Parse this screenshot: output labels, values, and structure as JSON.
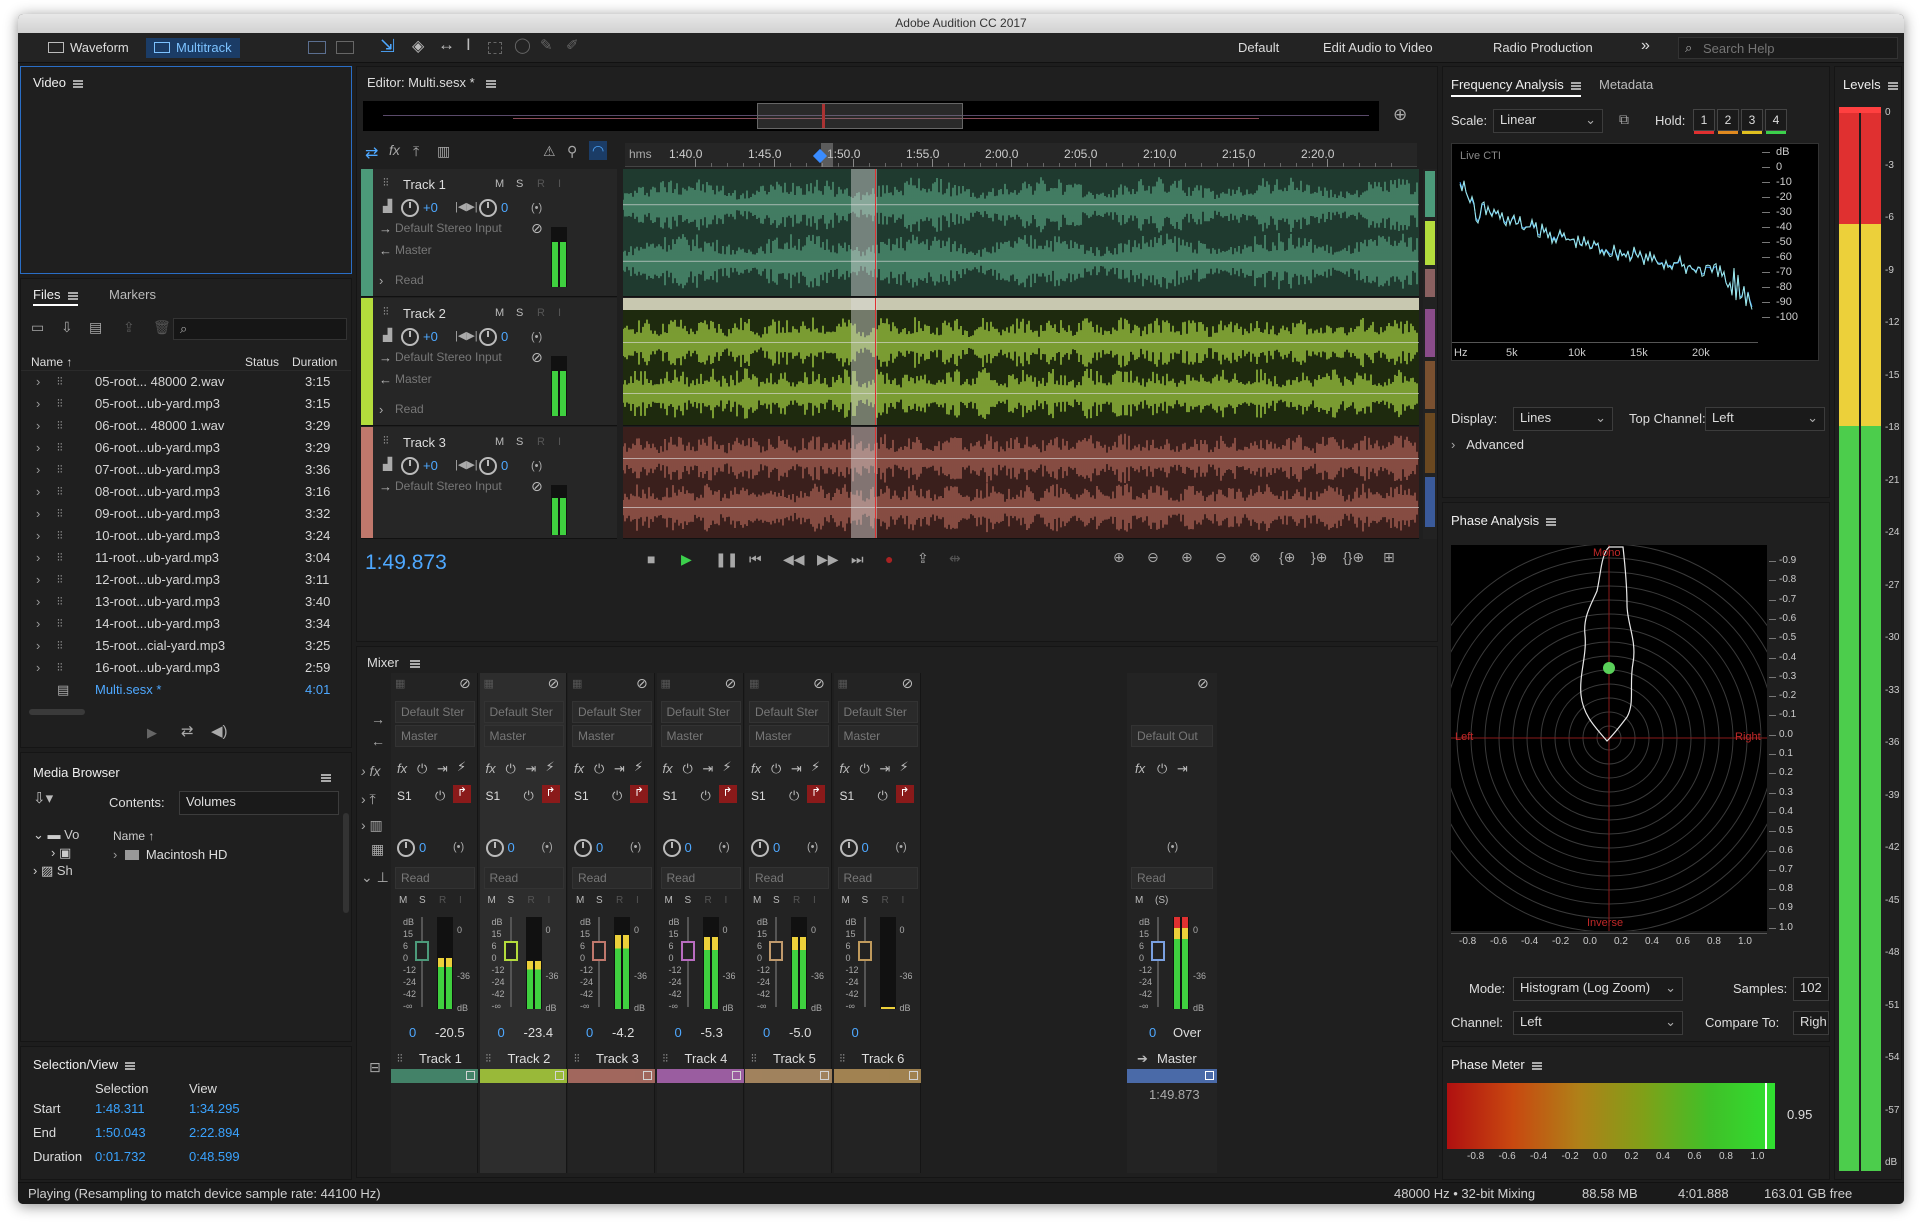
{
  "app": {
    "title": "Adobe Audition CC 2017"
  },
  "toolbar": {
    "waveform": "Waveform",
    "multitrack": "Multitrack",
    "workspaces": [
      "Default",
      "Edit Audio to Video",
      "Radio Production"
    ],
    "overflow": "»",
    "search_placeholder": "Search Help"
  },
  "video_panel": {
    "title": "Video"
  },
  "files_panel": {
    "tabs": [
      "Files",
      "Markers"
    ],
    "columns": {
      "name": "Name ↑",
      "status": "Status",
      "duration": "Duration"
    },
    "files": [
      {
        "name": "05-root... 48000 2.wav",
        "duration": "3:15"
      },
      {
        "name": "05-root...ub-yard.mp3",
        "duration": "3:15"
      },
      {
        "name": "06-root... 48000 1.wav",
        "duration": "3:29"
      },
      {
        "name": "06-root...ub-yard.mp3",
        "duration": "3:29"
      },
      {
        "name": "07-root...ub-yard.mp3",
        "duration": "3:36"
      },
      {
        "name": "08-root...ub-yard.mp3",
        "duration": "3:16"
      },
      {
        "name": "09-root...ub-yard.mp3",
        "duration": "3:32"
      },
      {
        "name": "10-root...ub-yard.mp3",
        "duration": "3:24"
      },
      {
        "name": "11-root...ub-yard.mp3",
        "duration": "3:04"
      },
      {
        "name": "12-root...ub-yard.mp3",
        "duration": "3:11"
      },
      {
        "name": "13-root...ub-yard.mp3",
        "duration": "3:40"
      },
      {
        "name": "14-root...ub-yard.mp3",
        "duration": "3:34"
      },
      {
        "name": "15-root...cial-yard.mp3",
        "duration": "3:25"
      },
      {
        "name": "16-root...ub-yard.mp3",
        "duration": "2:59"
      }
    ],
    "session": {
      "name": "Multi.sesx *",
      "duration": "4:01"
    }
  },
  "media_browser": {
    "title": "Media Browser",
    "contents_label": "Contents:",
    "contents_value": "Volumes",
    "tree": [
      "Vo",
      "Sh"
    ],
    "name_col": "Name ↑",
    "item": "Macintosh HD"
  },
  "selection_view": {
    "title": "Selection/View",
    "col_selection": "Selection",
    "col_view": "View",
    "rows": [
      {
        "label": "Start",
        "selection": "1:48.311",
        "view": "1:34.295"
      },
      {
        "label": "End",
        "selection": "1:50.043",
        "view": "2:22.894"
      },
      {
        "label": "Duration",
        "selection": "0:01.732",
        "view": "0:48.599"
      }
    ]
  },
  "editor": {
    "title": "Editor: Multi.sesx *",
    "ruler_unit": "hms",
    "ruler_ticks": [
      "1:40.0",
      "1:45.0",
      "1:50.0",
      "1:55.0",
      "2:00.0",
      "2:05.0",
      "2:10.0",
      "2:15.0",
      "2:20.0"
    ],
    "time": "1:49.873",
    "tracks": [
      {
        "name": "Track 1",
        "vol": "+0",
        "pan": "0",
        "input": "Default Stereo Input",
        "output": "Master",
        "mode": "Read",
        "color": "#4c9a7a"
      },
      {
        "name": "Track 2",
        "vol": "+0",
        "pan": "0",
        "input": "Default Stereo Input",
        "output": "Master",
        "mode": "Read",
        "color": "#b4dc3c"
      },
      {
        "name": "Track 3",
        "vol": "+0",
        "pan": "0",
        "input": "Default Stereo Input",
        "color": "#c0786c"
      }
    ],
    "msri": [
      "M",
      "S",
      "R",
      "I"
    ]
  },
  "mixer": {
    "title": "Mixer",
    "strips": [
      {
        "name": "Track 1",
        "input": "Default Ster",
        "output": "Master",
        "send": "S1",
        "pan": "0",
        "mode": "Read",
        "vol": "0",
        "peak": "-20.5",
        "color": "#4c9a7a",
        "peak_level": 0.55
      },
      {
        "name": "Track 2",
        "input": "Default Ster",
        "output": "Master",
        "send": "S1",
        "pan": "0",
        "mode": "Read",
        "vol": "0",
        "peak": "-23.4",
        "color": "#b4dc3c",
        "peak_level": 0.52
      },
      {
        "name": "Track 3",
        "input": "Default Ster",
        "output": "Master",
        "send": "S1",
        "pan": "0",
        "mode": "Read",
        "vol": "0",
        "peak": "-4.2",
        "color": "#c0786c",
        "peak_level": 0.8
      },
      {
        "name": "Track 4",
        "input": "Default Ster",
        "output": "Master",
        "send": "S1",
        "pan": "0",
        "mode": "Read",
        "vol": "0",
        "peak": "-5.3",
        "color": "#b86cc0",
        "peak_level": 0.78
      },
      {
        "name": "Track 5",
        "input": "Default Ster",
        "output": "Master",
        "send": "S1",
        "pan": "0",
        "mode": "Read",
        "vol": "0",
        "peak": "-5.0",
        "color": "#c09a6c",
        "peak_level": 0.78
      },
      {
        "name": "Track 6",
        "input": "Default Ster",
        "output": "Master",
        "send": "S1",
        "pan": "0",
        "mode": "Read",
        "vol": "0",
        "peak": "",
        "color": "#c09a5c",
        "peak_level": 0.0
      }
    ],
    "master": {
      "name": "Master",
      "output": "Default Out",
      "mode": "Read",
      "vol": "0",
      "peak": "Over",
      "ms": "M",
      "s": "(S)",
      "time": "1:49.873"
    },
    "db_scale": [
      "dB",
      "15",
      "6",
      "0",
      "-12",
      "-24",
      "-42",
      "-∞"
    ],
    "meter_scale": [
      "0",
      "-36",
      "dB"
    ]
  },
  "freq_analysis": {
    "tabs": [
      "Frequency Analysis",
      "Metadata"
    ],
    "scale_label": "Scale:",
    "scale_value": "Linear",
    "hold_label": "Hold:",
    "hold_buttons": [
      "1",
      "2",
      "3",
      "4"
    ],
    "live": "Live CTI",
    "db_ticks": [
      "dB",
      "0",
      "-10",
      "-20",
      "-30",
      "-40",
      "-50",
      "-60",
      "-70",
      "-80",
      "-90",
      "-100"
    ],
    "hz_ticks": [
      "Hz",
      "5k",
      "10k",
      "15k",
      "20k"
    ],
    "display_label": "Display:",
    "display_value": "Lines",
    "channel_label": "Top Channel:",
    "channel_value": "Left",
    "advanced": "Advanced"
  },
  "phase_analysis": {
    "title": "Phase Analysis",
    "mono": "Mono",
    "left": "Left",
    "right": "Right",
    "inverse": "Inverse",
    "right_ticks": [
      "-0.9",
      "-0.8",
      "-0.7",
      "-0.6",
      "-0.5",
      "-0.4",
      "-0.3",
      "-0.2",
      "-0.1",
      "0.0",
      "0.1",
      "0.2",
      "0.3",
      "0.4",
      "0.5",
      "0.6",
      "0.7",
      "0.8",
      "0.9",
      "1.0"
    ],
    "bottom_ticks": [
      "-0.8",
      "-0.6",
      "-0.4",
      "-0.2",
      "0.0",
      "0.2",
      "0.4",
      "0.6",
      "0.8",
      "1.0"
    ],
    "mode_label": "Mode:",
    "mode_value": "Histogram (Log Zoom)",
    "samples_label": "Samples:",
    "samples_value": "102",
    "channel_label": "Channel:",
    "channel_value": "Left",
    "compare_label": "Compare To:",
    "compare_value": "Righ"
  },
  "phase_meter": {
    "title": "Phase Meter",
    "value": "0.95",
    "ticks": [
      "-0.8",
      "-0.6",
      "-0.4",
      "-0.2",
      "0.0",
      "0.2",
      "0.4",
      "0.6",
      "0.8",
      "1.0"
    ]
  },
  "levels": {
    "title": "Levels",
    "ticks": [
      "0",
      "-3",
      "-6",
      "-9",
      "-12",
      "-15",
      "-18",
      "-21",
      "-24",
      "-27",
      "-30",
      "-33",
      "-36",
      "-39",
      "-42",
      "-45",
      "-48",
      "-51",
      "-54",
      "-57",
      "dB"
    ]
  },
  "status": {
    "message": "Playing (Resampling to match device sample rate: 44100 Hz)",
    "sample_rate": "48000 Hz • 32-bit Mixing",
    "memory": "88.58 MB",
    "duration": "4:01.888",
    "disk": "163.01 GB free"
  }
}
